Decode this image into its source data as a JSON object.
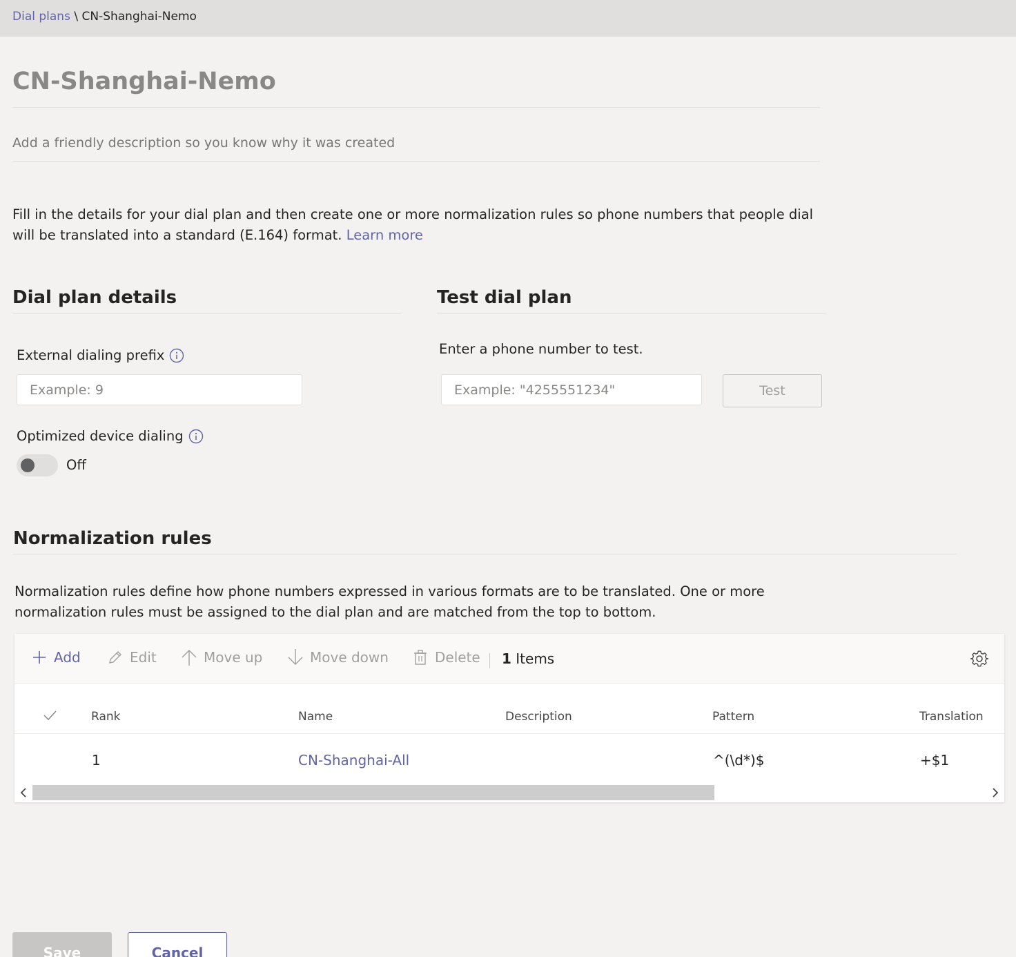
{
  "breadcrumb": {
    "parent": "Dial plans",
    "separator": " \\ ",
    "current": "CN-Shanghai-Nemo"
  },
  "page_title": "CN-Shanghai-Nemo",
  "description_placeholder": "Add a friendly description so you know why it was created",
  "intro": {
    "text": "Fill in the details for your dial plan and then create one or more normalization rules so phone numbers that people dial will be translated into a standard (E.164) format. ",
    "link": "Learn more"
  },
  "dial_plan_details": {
    "heading": "Dial plan details",
    "external_prefix_label": "External dialing prefix",
    "external_prefix_placeholder": "Example: 9",
    "optimized_label": "Optimized device dialing",
    "optimized_state": "Off"
  },
  "test_dial_plan": {
    "heading": "Test dial plan",
    "prompt": "Enter a phone number to test.",
    "placeholder": "Example: \"4255551234\"",
    "button": "Test"
  },
  "normalization": {
    "heading": "Normalization rules",
    "description": "Normalization rules define how phone numbers expressed in various formats are to be translated. One or more normalization rules must be assigned to the dial plan and are matched from the top to bottom.",
    "toolbar": {
      "add": "Add",
      "edit": "Edit",
      "move_up": "Move up",
      "move_down": "Move down",
      "delete": "Delete",
      "count": "1",
      "count_label": "Items"
    },
    "columns": {
      "rank": "Rank",
      "name": "Name",
      "description": "Description",
      "pattern": "Pattern",
      "translation": "Translation"
    },
    "rows": [
      {
        "rank": "1",
        "name": "CN-Shanghai-All",
        "description": "",
        "pattern": "^(\\d*)$",
        "translation": "+$1"
      }
    ]
  },
  "footer": {
    "save": "Save",
    "cancel": "Cancel"
  },
  "colors": {
    "accent": "#6264a7",
    "background": "#f3f2f1",
    "header": "#e1dfdd"
  }
}
